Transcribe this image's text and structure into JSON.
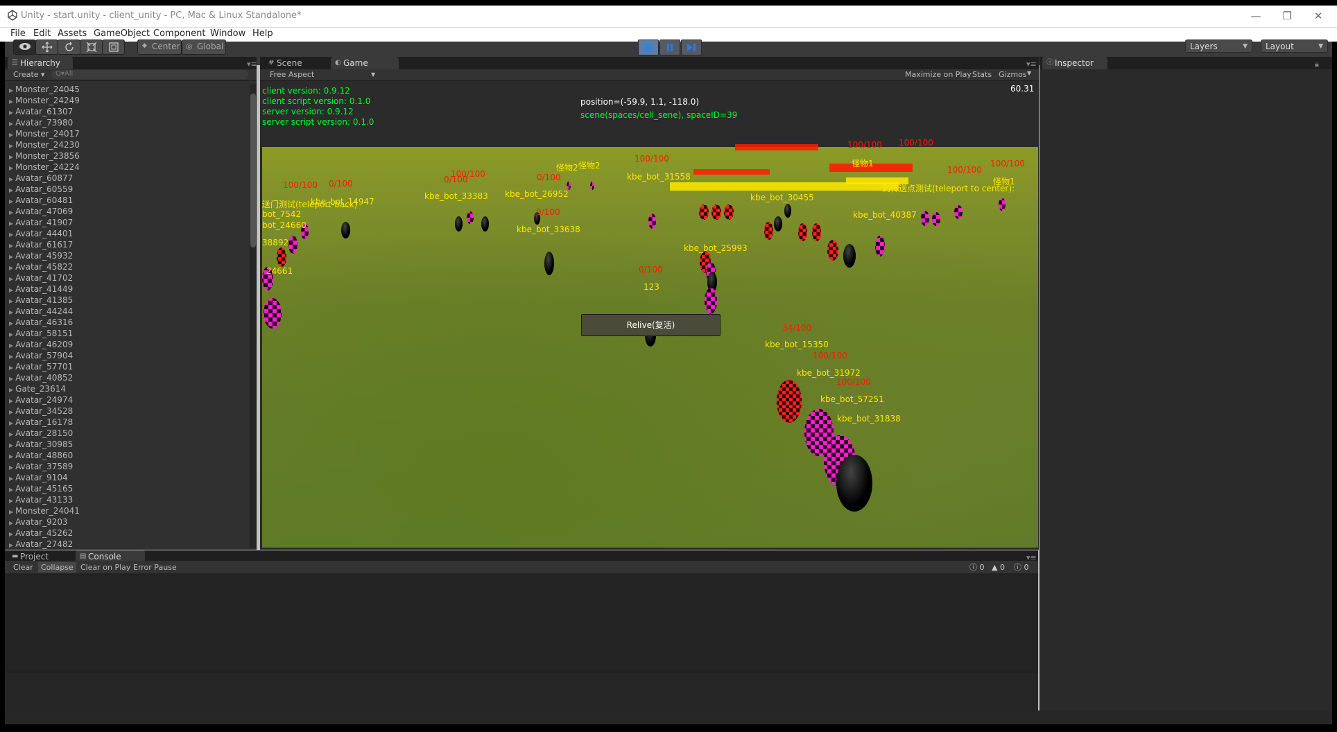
{
  "window": {
    "title": "Unity - start.unity - client_unity - PC, Mac & Linux Standalone*",
    "controls": [
      "—",
      "❐",
      "✕"
    ]
  },
  "menu": [
    "File",
    "Edit",
    "Assets",
    "GameObject",
    "Component",
    "Window",
    "Help"
  ],
  "toolbar": {
    "pivot_label": "Center",
    "space_label": "Global",
    "layers_label": "Layers",
    "layout_label": "Layout"
  },
  "hierarchy": {
    "tab_label": "Hierarchy",
    "create_label": "Create",
    "search_placeholder": "Q▾All",
    "items": [
      "Monster_24045",
      "Monster_24249",
      "Avatar_61307",
      "Avatar_73980",
      "Monster_24017",
      "Monster_24230",
      "Monster_23856",
      "Monster_24224",
      "Avatar_60877",
      "Avatar_60559",
      "Avatar_60481",
      "Avatar_47069",
      "Avatar_41907",
      "Avatar_44401",
      "Avatar_61617",
      "Avatar_45932",
      "Avatar_45822",
      "Avatar_41702",
      "Avatar_41449",
      "Avatar_41385",
      "Avatar_44244",
      "Avatar_46316",
      "Avatar_58151",
      "Avatar_46209",
      "Avatar_57904",
      "Avatar_57701",
      "Avatar_40852",
      "Gate_23614",
      "Avatar_24974",
      "Avatar_34528",
      "Avatar_16178",
      "Avatar_28150",
      "Avatar_30985",
      "Avatar_48860",
      "Avatar_37589",
      "Avatar_9104",
      "Avatar_45165",
      "Avatar_43133",
      "Monster_24041",
      "Avatar_9203",
      "Avatar_45262",
      "Avatar_27482"
    ]
  },
  "scene_tabs": {
    "scene_label": "Scene",
    "game_label": "Game",
    "aspect_label": "Free Aspect",
    "maximize_label": "Maximize on Play",
    "stats_label": "Stats",
    "gizmos_label": "Gizmos"
  },
  "game_overlay": {
    "client_version": "client version: 0.9.12",
    "client_script_version": "client script version: 0.1.0",
    "server_version": "server version: 0.9.12",
    "server_script_version": "server script version: 0.1.0",
    "position": "position=(-59.9, 1.1, -118.0)",
    "scene": "scene(spaces/cell_sene), spaceID=39",
    "fps": "60.31",
    "relive_label": "Relive(复活)"
  },
  "game_labels": [
    {
      "t": "100/100",
      "c": "red"
    },
    {
      "t": "0/100",
      "c": "red"
    },
    {
      "t": "kbe_bot_14947",
      "c": "yellow"
    },
    {
      "t": "送门测试(teleport-back)",
      "c": "yellow"
    },
    {
      "t": "bot_7542",
      "c": "yellow"
    },
    {
      "t": "bot_24660",
      "c": "yellow"
    },
    {
      "t": "38892",
      "c": "yellow"
    },
    {
      "t": "24661",
      "c": "yellow"
    },
    {
      "t": "0/100",
      "c": "red"
    },
    {
      "t": "kbe_bot_33638",
      "c": "yellow"
    },
    {
      "t": "kbe_bot_26952",
      "c": "yellow"
    },
    {
      "t": "0/100",
      "c": "red"
    },
    {
      "t": "0/100",
      "c": "red"
    },
    {
      "t": "123",
      "c": "yellow"
    },
    {
      "t": "kbe_bot_25993",
      "c": "yellow"
    },
    {
      "t": "怪物2",
      "c": "yellow"
    },
    {
      "t": "怪物2",
      "c": "yellow"
    },
    {
      "t": "kbe_bot_31558",
      "c": "yellow"
    },
    {
      "t": "100/100",
      "c": "red"
    },
    {
      "t": "怪物1",
      "c": "yellow"
    },
    {
      "t": "100/100",
      "c": "red"
    },
    {
      "t": "100/100",
      "c": "red"
    },
    {
      "t": "kbe_bot_30455",
      "c": "yellow"
    },
    {
      "t": "kbe_bot_40387",
      "c": "yellow"
    },
    {
      "t": "34/100",
      "c": "red"
    },
    {
      "t": "kbe_bot_15350",
      "c": "yellow"
    },
    {
      "t": "100/100",
      "c": "red"
    },
    {
      "t": "kbe_bot_31972",
      "c": "yellow"
    },
    {
      "t": "100/100",
      "c": "red"
    },
    {
      "t": "kbe_bot_57251",
      "c": "yellow"
    },
    {
      "t": "kbe_bot_31838",
      "c": "yellow"
    },
    {
      "t": "怪物1",
      "c": "yellow"
    },
    {
      "t": "100/100",
      "c": "red"
    },
    {
      "t": "到传送点测试(teleport to center):",
      "c": "yellow"
    },
    {
      "t": "100/100",
      "c": "red"
    },
    {
      "t": "kbe_bot_33383",
      "c": "yellow"
    },
    {
      "t": "100/100",
      "c": "red"
    },
    {
      "t": "0/100",
      "c": "red"
    }
  ],
  "bottom_tabs": {
    "project_label": "Project",
    "console_label": "Console",
    "clear_label": "Clear",
    "collapse_label": "Collapse",
    "clear_on_play_label": "Clear on Play",
    "error_pause_label": "Error Pause",
    "info_count": "0",
    "warn_count": "0",
    "error_count": "0"
  },
  "inspector": {
    "tab_label": "Inspector"
  },
  "colors": {
    "accent_play": "#5a7ea8",
    "overlay_green": "#00ff2a",
    "label_yellow": "#ffe600",
    "label_red": "#ff1a00"
  }
}
